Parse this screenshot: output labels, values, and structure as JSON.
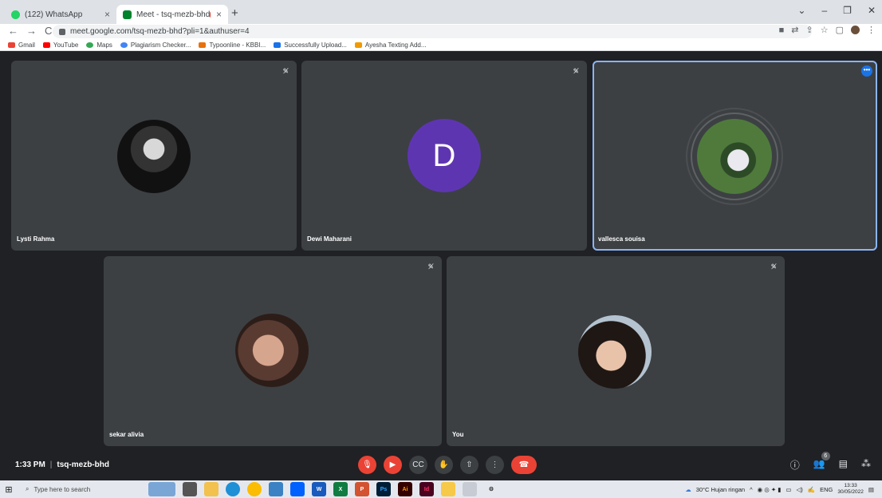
{
  "browser": {
    "tabs": [
      {
        "title": "(122) WhatsApp",
        "close": "×",
        "color": "#25d366"
      },
      {
        "title": "Meet - tsq-mezb-bhd",
        "close": "×",
        "color": "#00832d"
      }
    ],
    "new_tab": "+",
    "window_controls": [
      "⌄",
      "–",
      "❐",
      "✕"
    ],
    "url": "meet.google.com/tsq-mezb-bhd?pli=1&authuser=4",
    "nav": {
      "back": "←",
      "forward": "→",
      "reload": "C"
    },
    "bookmarks": [
      {
        "label": "Gmail",
        "color": "#ea4335"
      },
      {
        "label": "YouTube",
        "color": "#ff0000"
      },
      {
        "label": "Maps",
        "color": "#34a853"
      },
      {
        "label": "Plagiarism Checker...",
        "color": "#4285f4"
      },
      {
        "label": "Typoonline - KBBI...",
        "color": "#e8710a"
      },
      {
        "label": "Successfully Upload...",
        "color": "#1a73e8"
      },
      {
        "label": "Ayesha Texting Add...",
        "color": "#f29900"
      }
    ]
  },
  "participants": [
    {
      "name": "Lysti Rahma"
    },
    {
      "name": "Dewi Maharani",
      "initial": "D"
    },
    {
      "name": "vallesca souisa"
    },
    {
      "name": "sekar alivia"
    },
    {
      "name": "You"
    }
  ],
  "meeting": {
    "time": "1:33 PM",
    "separator": "|",
    "code": "tsq-mezb-bhd",
    "people_count": "6"
  },
  "taskbar": {
    "search_placeholder": "Type here to search",
    "weather": "30°C  Hujan ringan",
    "language": "ENG",
    "time": "13:33",
    "date": "30/05/2022"
  }
}
